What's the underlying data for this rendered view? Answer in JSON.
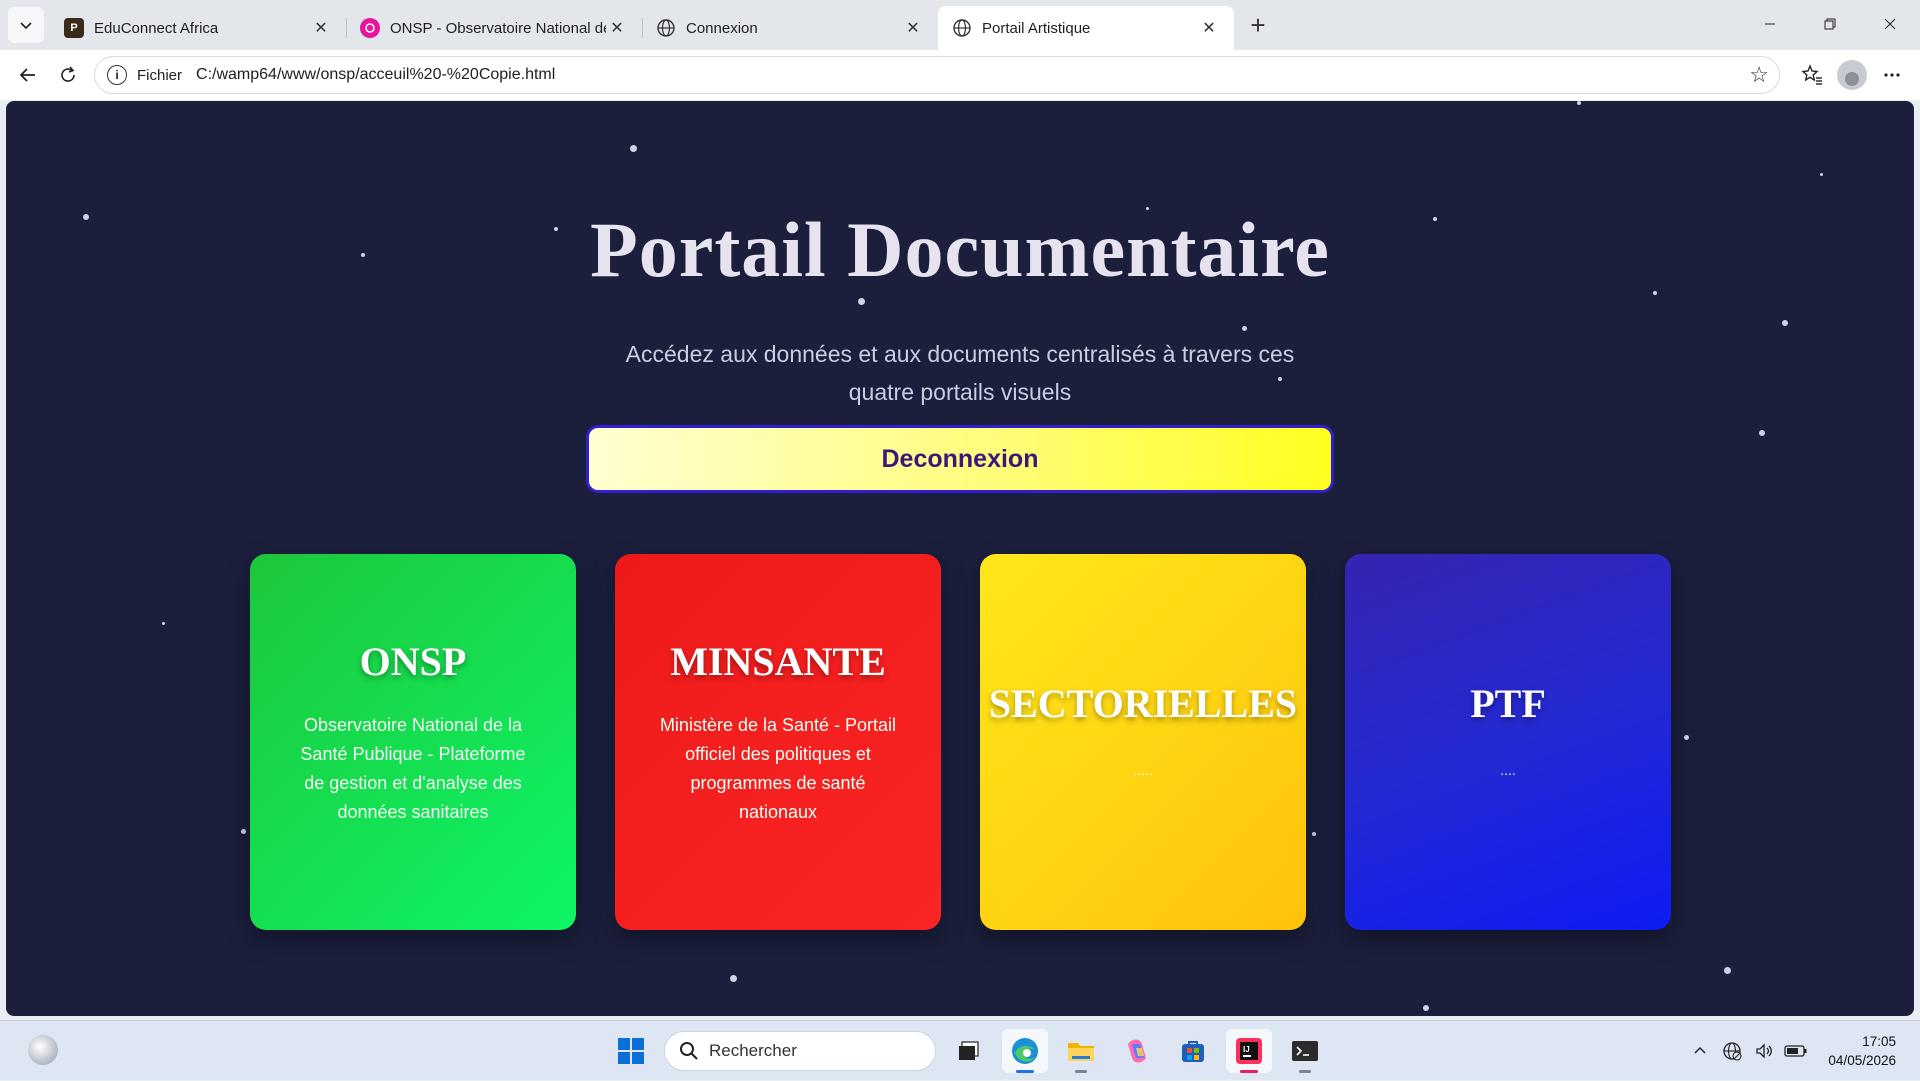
{
  "browser": {
    "tabs": [
      {
        "title": "EduConnect Africa",
        "favicon": "educonnect-favicon",
        "favicon_color": "#3a2a1a",
        "favicon_text": "P",
        "active": false
      },
      {
        "title": "ONSP - Observatoire National de la Santé Publique",
        "favicon": "onsp-favicon",
        "favicon_color": "#e5169b",
        "favicon_text": "",
        "active": false
      },
      {
        "title": "Connexion",
        "favicon": "globe-icon",
        "active": false
      },
      {
        "title": "Portail Artistique",
        "favicon": "globe-icon",
        "active": true
      }
    ],
    "close_glyph": "✕",
    "new_tab_glyph": "+",
    "address": {
      "scheme_label": "Fichier",
      "url": "C:/wamp64/www/onsp/acceuil%20-%20Copie.html"
    }
  },
  "page": {
    "title": "Portail Documentaire",
    "subtitle": "Accédez aux données et aux documents centralisés à travers ces quatre portails visuels",
    "logout_label": "Deconnexion",
    "cards": [
      {
        "id": "onsp",
        "title": "ONSP",
        "description": "Observatoire National de la Santé Publique - Plateforme de gestion et d'analyse des données sanitaires",
        "color": "#16e04f"
      },
      {
        "id": "minsante",
        "title": "MINSANTE",
        "description": "Ministère de la Santé - Portail officiel des politiques et programmes de santé nationaux",
        "color": "#f21e1e"
      },
      {
        "id": "sectorielles",
        "title": "SECTORIELLES",
        "description": ".....",
        "color": "#ffd413"
      },
      {
        "id": "ptf",
        "title": "PTF",
        "description": "....",
        "color": "#1d22e0"
      }
    ],
    "background_color": "#1b1f3c",
    "logout_border_color": "#2f1fcf"
  },
  "taskbar": {
    "search_placeholder": "Rechercher",
    "time": "17:05",
    "date": "04/05/2026"
  }
}
